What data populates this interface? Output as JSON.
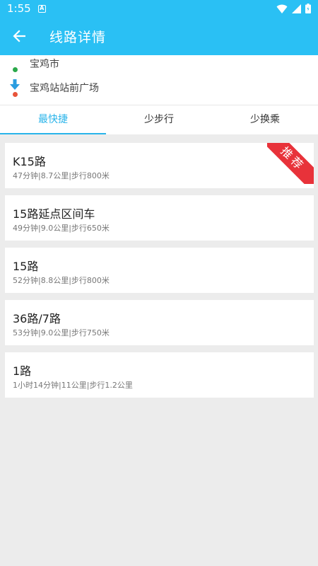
{
  "status_bar": {
    "time": "1:55",
    "notification_glyph": "A"
  },
  "app_bar": {
    "title": "线路详情"
  },
  "route": {
    "origin": "宝鸡市",
    "destination": "宝鸡站站前广场"
  },
  "tabs": [
    {
      "label": "最快捷"
    },
    {
      "label": "少步行"
    },
    {
      "label": "少换乘"
    }
  ],
  "recommend_badge": "推荐",
  "routes": [
    {
      "name": "K15路",
      "meta": "47分钟|8.7公里|步行800米"
    },
    {
      "name": "15路延点区间车",
      "meta": "49分钟|9.0公里|步行650米"
    },
    {
      "name": "15路",
      "meta": "52分钟|8.8公里|步行800米"
    },
    {
      "name": "36路/7路",
      "meta": "53分钟|9.0公里|步行750米"
    },
    {
      "name": "1路",
      "meta": "1小时14分钟|11公里|步行1.2公里"
    }
  ],
  "colors": {
    "accent": "#2ac0f4",
    "origin_dot": "#2aa84a",
    "destination_dot": "#e8543a",
    "badge": "#e8323a"
  }
}
